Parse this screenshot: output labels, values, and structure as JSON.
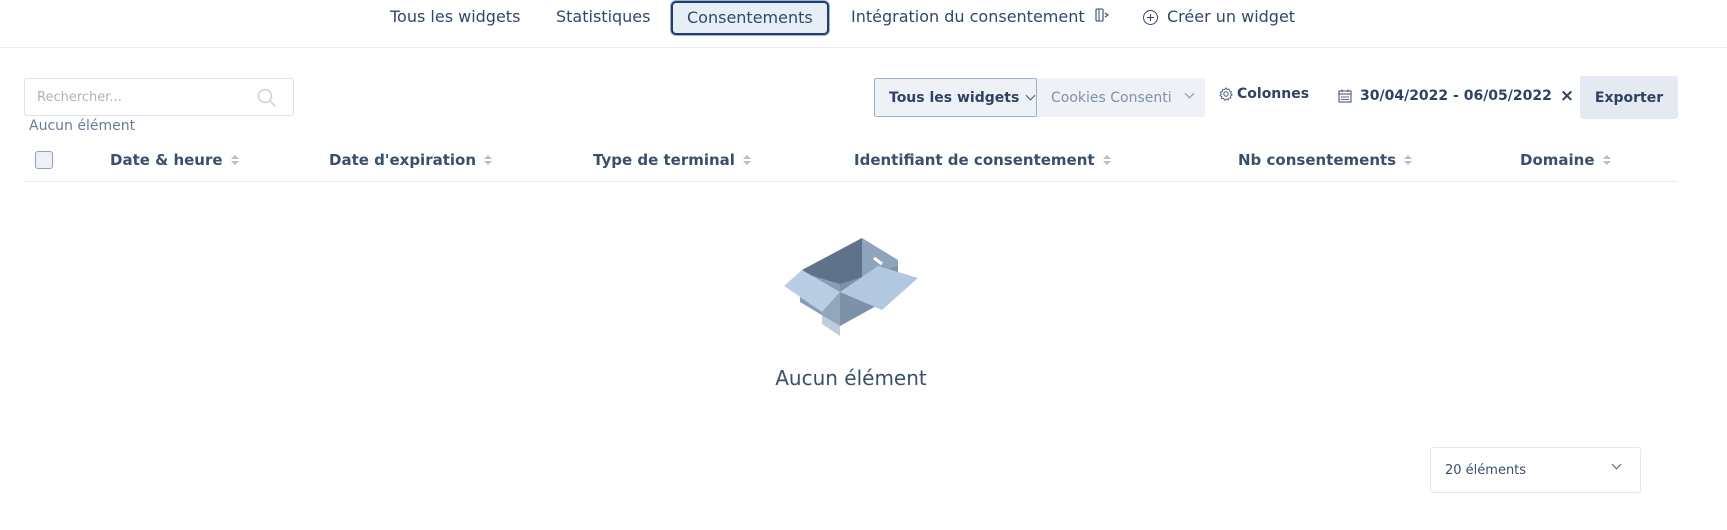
{
  "nav": {
    "tabs": [
      {
        "label": "Tous les widgets"
      },
      {
        "label": "Statistiques"
      },
      {
        "label": "Consentements",
        "active": true
      },
      {
        "label": "Intégration du consentement",
        "icon": "external-link-icon"
      },
      {
        "label": "Créer un widget",
        "icon": "plus-circle-icon"
      }
    ]
  },
  "toolbar": {
    "search_placeholder": "Rechercher...",
    "empty_label": "Aucun élément",
    "widget_filter": "Tous les widgets",
    "category_filter": "Cookies Consenti",
    "columns_label": "Colonnes",
    "date_range": "30/04/2022 - 06/05/2022",
    "export_label": "Exporter"
  },
  "table": {
    "columns": [
      {
        "label": "Date & heure"
      },
      {
        "label": "Date d'expiration"
      },
      {
        "label": "Type de terminal"
      },
      {
        "label": "Identifiant de consentement"
      },
      {
        "label": "Nb consentements"
      },
      {
        "label": "Domaine"
      }
    ],
    "rows": [],
    "empty_message": "Aucun élément"
  },
  "pagination": {
    "page_size": "20 éléments"
  },
  "colors": {
    "primary_text": "#3b4f6b",
    "active_border": "#1e3f6e",
    "button_bg": "#e5eaf2"
  }
}
